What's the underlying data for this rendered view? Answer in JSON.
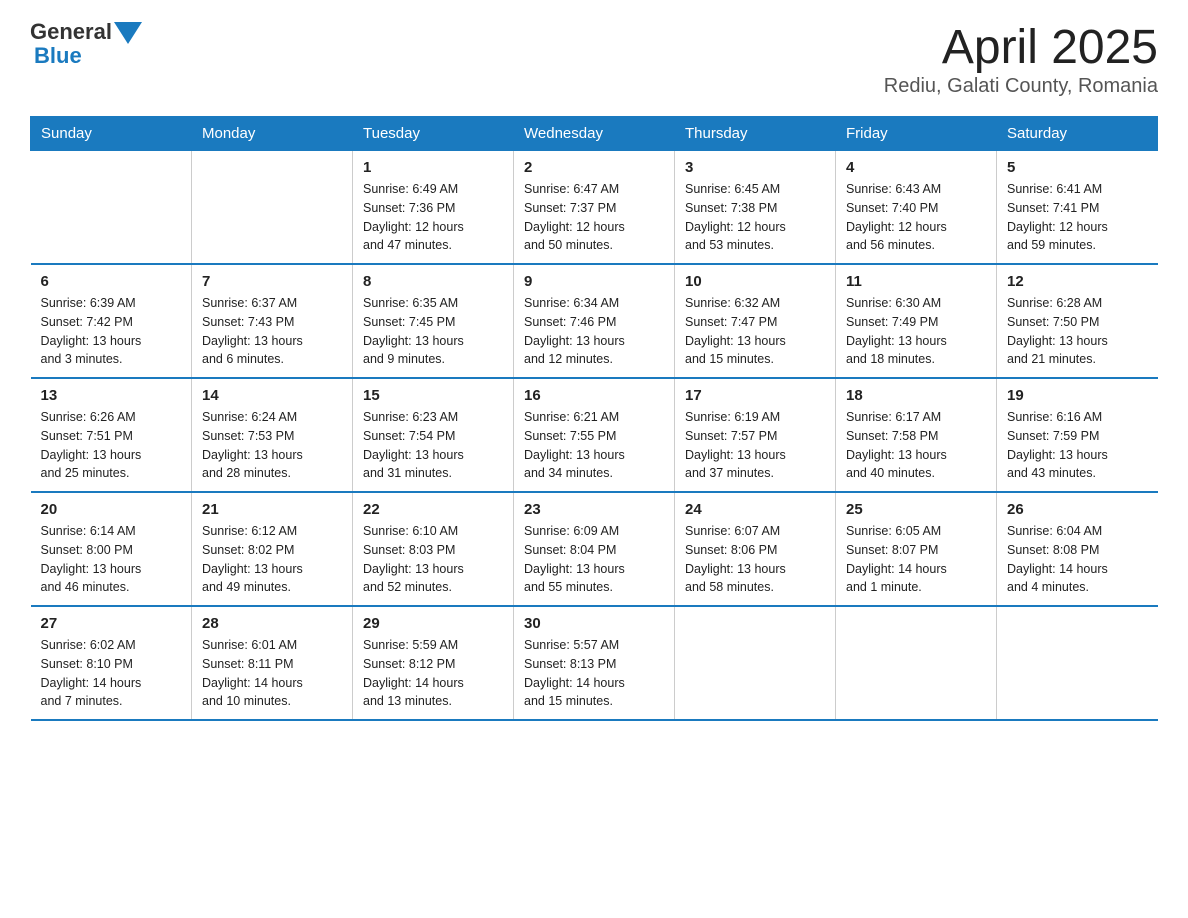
{
  "header": {
    "logo_general": "General",
    "logo_blue": "Blue",
    "title": "April 2025",
    "subtitle": "Rediu, Galati County, Romania"
  },
  "calendar": {
    "days_of_week": [
      "Sunday",
      "Monday",
      "Tuesday",
      "Wednesday",
      "Thursday",
      "Friday",
      "Saturday"
    ],
    "weeks": [
      [
        {
          "day": "",
          "info": ""
        },
        {
          "day": "",
          "info": ""
        },
        {
          "day": "1",
          "info": "Sunrise: 6:49 AM\nSunset: 7:36 PM\nDaylight: 12 hours\nand 47 minutes."
        },
        {
          "day": "2",
          "info": "Sunrise: 6:47 AM\nSunset: 7:37 PM\nDaylight: 12 hours\nand 50 minutes."
        },
        {
          "day": "3",
          "info": "Sunrise: 6:45 AM\nSunset: 7:38 PM\nDaylight: 12 hours\nand 53 minutes."
        },
        {
          "day": "4",
          "info": "Sunrise: 6:43 AM\nSunset: 7:40 PM\nDaylight: 12 hours\nand 56 minutes."
        },
        {
          "day": "5",
          "info": "Sunrise: 6:41 AM\nSunset: 7:41 PM\nDaylight: 12 hours\nand 59 minutes."
        }
      ],
      [
        {
          "day": "6",
          "info": "Sunrise: 6:39 AM\nSunset: 7:42 PM\nDaylight: 13 hours\nand 3 minutes."
        },
        {
          "day": "7",
          "info": "Sunrise: 6:37 AM\nSunset: 7:43 PM\nDaylight: 13 hours\nand 6 minutes."
        },
        {
          "day": "8",
          "info": "Sunrise: 6:35 AM\nSunset: 7:45 PM\nDaylight: 13 hours\nand 9 minutes."
        },
        {
          "day": "9",
          "info": "Sunrise: 6:34 AM\nSunset: 7:46 PM\nDaylight: 13 hours\nand 12 minutes."
        },
        {
          "day": "10",
          "info": "Sunrise: 6:32 AM\nSunset: 7:47 PM\nDaylight: 13 hours\nand 15 minutes."
        },
        {
          "day": "11",
          "info": "Sunrise: 6:30 AM\nSunset: 7:49 PM\nDaylight: 13 hours\nand 18 minutes."
        },
        {
          "day": "12",
          "info": "Sunrise: 6:28 AM\nSunset: 7:50 PM\nDaylight: 13 hours\nand 21 minutes."
        }
      ],
      [
        {
          "day": "13",
          "info": "Sunrise: 6:26 AM\nSunset: 7:51 PM\nDaylight: 13 hours\nand 25 minutes."
        },
        {
          "day": "14",
          "info": "Sunrise: 6:24 AM\nSunset: 7:53 PM\nDaylight: 13 hours\nand 28 minutes."
        },
        {
          "day": "15",
          "info": "Sunrise: 6:23 AM\nSunset: 7:54 PM\nDaylight: 13 hours\nand 31 minutes."
        },
        {
          "day": "16",
          "info": "Sunrise: 6:21 AM\nSunset: 7:55 PM\nDaylight: 13 hours\nand 34 minutes."
        },
        {
          "day": "17",
          "info": "Sunrise: 6:19 AM\nSunset: 7:57 PM\nDaylight: 13 hours\nand 37 minutes."
        },
        {
          "day": "18",
          "info": "Sunrise: 6:17 AM\nSunset: 7:58 PM\nDaylight: 13 hours\nand 40 minutes."
        },
        {
          "day": "19",
          "info": "Sunrise: 6:16 AM\nSunset: 7:59 PM\nDaylight: 13 hours\nand 43 minutes."
        }
      ],
      [
        {
          "day": "20",
          "info": "Sunrise: 6:14 AM\nSunset: 8:00 PM\nDaylight: 13 hours\nand 46 minutes."
        },
        {
          "day": "21",
          "info": "Sunrise: 6:12 AM\nSunset: 8:02 PM\nDaylight: 13 hours\nand 49 minutes."
        },
        {
          "day": "22",
          "info": "Sunrise: 6:10 AM\nSunset: 8:03 PM\nDaylight: 13 hours\nand 52 minutes."
        },
        {
          "day": "23",
          "info": "Sunrise: 6:09 AM\nSunset: 8:04 PM\nDaylight: 13 hours\nand 55 minutes."
        },
        {
          "day": "24",
          "info": "Sunrise: 6:07 AM\nSunset: 8:06 PM\nDaylight: 13 hours\nand 58 minutes."
        },
        {
          "day": "25",
          "info": "Sunrise: 6:05 AM\nSunset: 8:07 PM\nDaylight: 14 hours\nand 1 minute."
        },
        {
          "day": "26",
          "info": "Sunrise: 6:04 AM\nSunset: 8:08 PM\nDaylight: 14 hours\nand 4 minutes."
        }
      ],
      [
        {
          "day": "27",
          "info": "Sunrise: 6:02 AM\nSunset: 8:10 PM\nDaylight: 14 hours\nand 7 minutes."
        },
        {
          "day": "28",
          "info": "Sunrise: 6:01 AM\nSunset: 8:11 PM\nDaylight: 14 hours\nand 10 minutes."
        },
        {
          "day": "29",
          "info": "Sunrise: 5:59 AM\nSunset: 8:12 PM\nDaylight: 14 hours\nand 13 minutes."
        },
        {
          "day": "30",
          "info": "Sunrise: 5:57 AM\nSunset: 8:13 PM\nDaylight: 14 hours\nand 15 minutes."
        },
        {
          "day": "",
          "info": ""
        },
        {
          "day": "",
          "info": ""
        },
        {
          "day": "",
          "info": ""
        }
      ]
    ]
  }
}
